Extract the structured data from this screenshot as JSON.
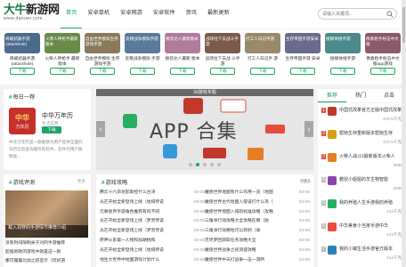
{
  "logo": {
    "name_a": "大牛",
    "name_b": "新游网",
    "url": "www.danuer.com"
  },
  "nav": [
    "首页",
    "安卓单机",
    "安卓网游",
    "安卓软件",
    "资讯",
    "最新更新"
  ],
  "search": {
    "placeholder": "请输入关键词..."
  },
  "apps": [
    {
      "alt": "奇峻武器手游(attackhole)",
      "name": "奇峻武器手游 (attackhole)",
      "btn": "下载",
      "color": "#4a6b8a"
    },
    {
      "alt": "火柴人神枪手最新版本",
      "name": "火柴人神枪手 最新版本",
      "btn": "下载",
      "color": "#6a8a4a"
    },
    {
      "alt": "自由世界模拟生存游戏手游",
      "name": "自由世界模拟 生存游戏手游",
      "btn": "下载",
      "color": "#8a7a5a"
    },
    {
      "alt": "反叛战争模拟手游",
      "name": "反叛战争模拟 手游",
      "btn": "下载",
      "color": "#5a7a9a"
    },
    {
      "alt": "换装达人最新版本",
      "name": "换装达人最新 版本",
      "btn": "下载",
      "color": "#b07a9a"
    },
    {
      "alt": "战场往下去战斗手游",
      "name": "战场往下去战 斗手游",
      "btn": "下载",
      "color": "#7a5a4a"
    },
    {
      "alt": "打工人日记手游",
      "name": "打工人日记手 游",
      "btn": "下载",
      "color": "#9a8a6a"
    },
    {
      "alt": "生存帝国手游安卓",
      "name": "生存帝国手游 安卓",
      "btn": "下载",
      "color": "#6a6a8a"
    },
    {
      "alt": "搜媒体搜手游",
      "name": "搜媒体搜手游",
      "btn": "下载",
      "color": "#4a8a8a"
    },
    {
      "alt": "像素枪手射击中文版",
      "name": "像素枪手射击中文 版app游戏 (mojiker.file)",
      "btn": "下载",
      "color": "#8a5a6a"
    }
  ],
  "daily": {
    "title": "每日一荐",
    "img_top": "中华",
    "img_bottom": "万年历",
    "name": "中华万年历",
    "category": "生活实用",
    "btn": "下载",
    "desc": "中华万年历是一款能够为用户提供全面的日历信息查询服务的软件，软件内用户能够查..."
  },
  "carousel": {
    "title": "3d游戏专题",
    "main": "APP 合集"
  },
  "rank": {
    "tabs": [
      "推荐",
      "热门",
      "点击"
    ],
    "items": [
      {
        "num": "1",
        "name": "中国式改革官方正版中国式改革",
        "size": "672.5千克",
        "color": "#c0392b"
      },
      {
        "num": "2",
        "name": "帮她生存重新版本帮她生存",
        "size": "672.5千克",
        "color": "#d4a017"
      },
      {
        "num": "3",
        "name": "火柴人战斗2最新版本火柴人",
        "size": "3MB",
        "color": "#e67e22"
      },
      {
        "num": "4",
        "name": "教授小姐姐的羊生物智能",
        "size": "3MB",
        "color": "#8e44ad"
      },
      {
        "num": "5",
        "name": "我的养殖人生手游我的养殖",
        "size": "413千克",
        "color": "#27ae60"
      },
      {
        "num": "6",
        "name": "中华美食小当家手游中华",
        "size": "413千克",
        "color": "#e74c3c"
      },
      {
        "num": "7",
        "name": "我的小镇生活手游官方版本",
        "size": "413千克",
        "color": "#2980b9"
      }
    ]
  },
  "news_left": {
    "title": "游戏攻略",
    "more": "更多",
    "items": [
      {
        "t": "腾云十六声龙影斯控什么台湾",
        "d": "03-05"
      },
      {
        "t": "光芒开始全新登场上线（地域传说",
        "d": "03-05"
      },
      {
        "t": "元尊星界手游角色推荐有何不同",
        "d": "03-05"
      },
      {
        "t": "光芒开始全新登场上线（梦灵传说",
        "d": "03-05"
      },
      {
        "t": "光芒开始全新登场上线（梦灵传说",
        "d": "03-05"
      },
      {
        "t": "原神火系第一人物和加胡桃和",
        "d": "03-05"
      },
      {
        "t": "光芒开始全新登场上线（地域传说",
        "d": "03-05"
      },
      {
        "t": "地生大世界中地面游戏计划什么",
        "d": "03-05"
      },
      {
        "t": "魔兽世界战争一击一在地里一提什么",
        "d": "03-05"
      }
    ]
  },
  "news_right": {
    "more": "更多",
    "items": [
      {
        "t": "魔兽世界地图有什么作用一览（地图",
        "d": "03-05"
      },
      {
        "t": "魔兽世界古代地图入侵该打什么鸟（",
        "d": "03-05"
      },
      {
        "t": "魔兽世界地图入侵的标准攻略（攻略",
        "d": "03-05"
      },
      {
        "t": "三角洲行动攻略大全攻略在哪（收",
        "d": "03-05"
      },
      {
        "t": "三角洲行动哪地可以领到（收",
        "d": "03-05"
      },
      {
        "t": "无尽梦回获取任务攻略大全",
        "d": "03-05"
      },
      {
        "t": "魔兽世界战争之初测速攻略",
        "d": "03-05"
      },
      {
        "t": "魔兽世界中天打战争一击一游所",
        "d": "03-05"
      },
      {
        "t": "魔兽世界战争地图合集（收",
        "d": "03-05"
      }
    ]
  },
  "review": {
    "title": "游戏评测",
    "more": "更多",
    "img_caption": "载入洞穿的手游情节推荐介绍",
    "items": [
      "没有时间限制关于对的手游推荐",
      "超强新款的游戏中就是这一款",
      "娜可露露比加之的宣示（玩好游"
    ]
  }
}
